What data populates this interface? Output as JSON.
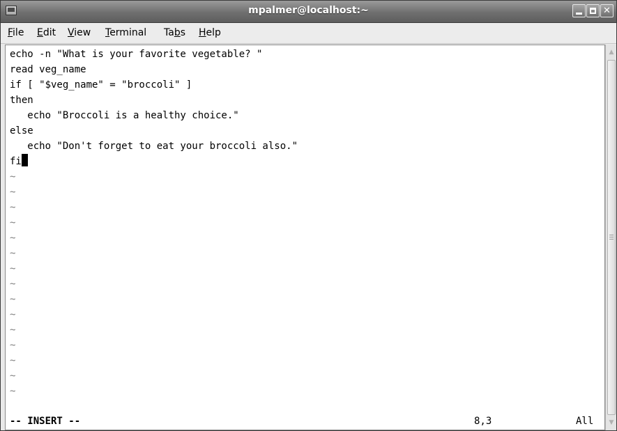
{
  "window": {
    "title": "mpalmer@localhost:~",
    "minimize_icon": "minimize-icon",
    "maximize_icon": "maximize-icon",
    "close_icon": "close-icon"
  },
  "menu": {
    "items": [
      {
        "mnemonic": "F",
        "rest": "ile"
      },
      {
        "mnemonic": "E",
        "rest": "dit"
      },
      {
        "mnemonic": "V",
        "rest": "iew"
      },
      {
        "mnemonic": "T",
        "rest": "erminal"
      },
      {
        "before": "Ta",
        "mnemonic": "b",
        "rest": "s"
      },
      {
        "mnemonic": "H",
        "rest": "elp"
      }
    ]
  },
  "editor": {
    "lines": [
      "echo -n \"What is your favorite vegetable? \"",
      "read veg_name",
      "if [ \"$veg_name\" = \"broccoli\" ]",
      "then",
      "   echo \"Broccoli is a healthy choice.\"",
      "else",
      "   echo \"Don't forget to eat your broccoli also.\"",
      "fi"
    ],
    "tilde": "~",
    "empty_lines": 15,
    "cursor_line": 8,
    "cursor_col": 3
  },
  "status": {
    "mode": "-- INSERT --",
    "position": "8,3",
    "scroll": "All"
  },
  "scrollbar": {
    "up_icon": "scroll-up-arrow-icon",
    "down_icon": "scroll-down-arrow-icon"
  }
}
